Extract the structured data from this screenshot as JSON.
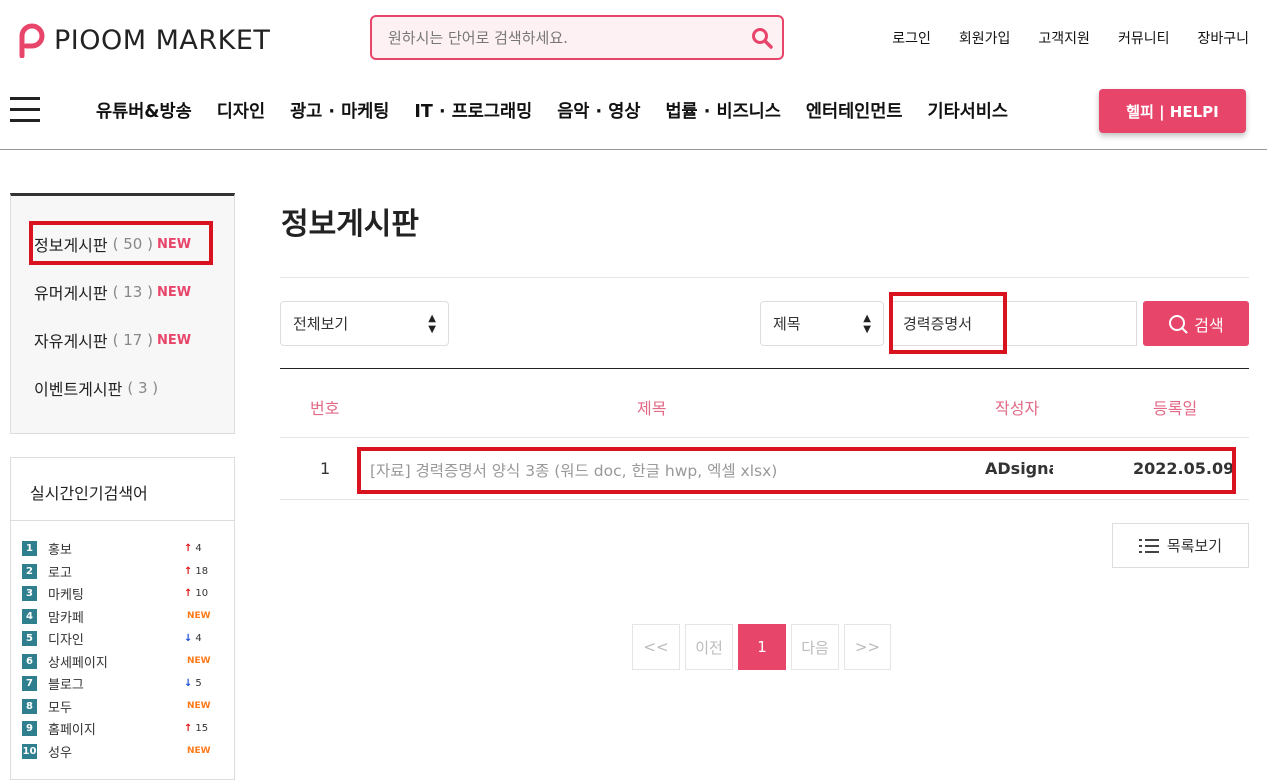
{
  "header": {
    "logo_text": "PIOOM MARKET",
    "search_placeholder": "원하시는 단어로 검색하세요.",
    "links": [
      "로그인",
      "회원가입",
      "고객지원",
      "커뮤니티",
      "장바구니"
    ]
  },
  "nav": {
    "items": [
      "유튜버&방송",
      "디자인",
      "광고 · 마케팅",
      "IT · 프로그래밍",
      "음악 · 영상",
      "법률 · 비즈니스",
      "엔터테인먼트",
      "기타서비스"
    ],
    "helpi_label": "헬피 | HELPI"
  },
  "sidebar": {
    "boards": [
      {
        "name": "정보게시판",
        "count": "( 50 )",
        "badge": "NEW"
      },
      {
        "name": "유머게시판",
        "count": "( 13 )",
        "badge": "NEW"
      },
      {
        "name": "자유게시판",
        "count": "( 17 )",
        "badge": "NEW"
      },
      {
        "name": "이벤트게시판",
        "count": "( 3 )",
        "badge": ""
      }
    ],
    "popular_title": "실시간인기검색어",
    "popular": [
      {
        "rank": "1",
        "keyword": "홍보",
        "dir": "up",
        "change": "4"
      },
      {
        "rank": "2",
        "keyword": "로고",
        "dir": "up",
        "change": "18"
      },
      {
        "rank": "3",
        "keyword": "마케팅",
        "dir": "up",
        "change": "10"
      },
      {
        "rank": "4",
        "keyword": "맘카페",
        "dir": "new",
        "change": "NEW"
      },
      {
        "rank": "5",
        "keyword": "디자인",
        "dir": "down",
        "change": "4"
      },
      {
        "rank": "6",
        "keyword": "상세페이지",
        "dir": "new",
        "change": "NEW"
      },
      {
        "rank": "7",
        "keyword": "블로그",
        "dir": "down",
        "change": "5"
      },
      {
        "rank": "8",
        "keyword": "모두",
        "dir": "new",
        "change": "NEW"
      },
      {
        "rank": "9",
        "keyword": "홈페이지",
        "dir": "up",
        "change": "15"
      },
      {
        "rank": "10",
        "keyword": "성우",
        "dir": "new",
        "change": "NEW"
      }
    ]
  },
  "main": {
    "title": "정보게시판",
    "filter_select": "전체보기",
    "field_select": "제목",
    "search_value": "경력증명서",
    "search_button": "검색",
    "columns": [
      "번호",
      "제목",
      "작성자",
      "등록일"
    ],
    "rows": [
      {
        "no": "1",
        "title": "[자료] 경력증명서 양식 3종 (워드 doc, 한글 hwp, 엑셀 xlsx)",
        "author": "ADsignag",
        "date": "2022.05.09"
      }
    ],
    "list_button": "목록보기",
    "pagination": [
      "<<",
      "이전",
      "1",
      "다음",
      ">>"
    ]
  }
}
